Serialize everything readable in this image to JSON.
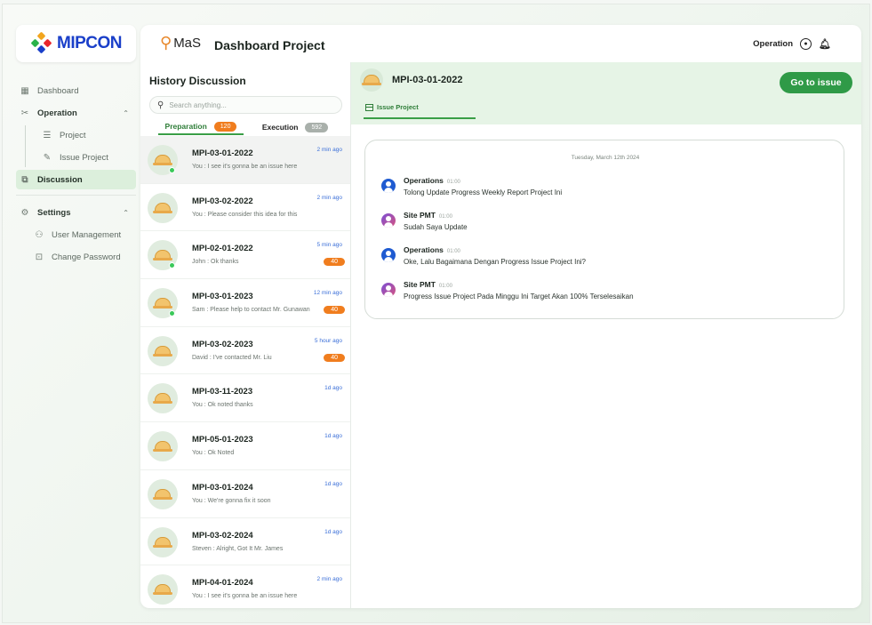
{
  "brand": {
    "logo_text": "MIPCON",
    "colors": {
      "brand_blue": "#1a3fc9",
      "accent_green": "#2f9a47",
      "badge_orange": "#f07d1e"
    }
  },
  "sidebar": {
    "items": [
      {
        "label": "Dashboard",
        "icon": "grid-icon"
      },
      {
        "label": "Operation",
        "icon": "tools-icon"
      },
      {
        "label": "Project",
        "icon": "lines-icon"
      },
      {
        "label": "Issue Project",
        "icon": "pencil-icon"
      },
      {
        "label": "Discussion",
        "icon": "chat-icon"
      },
      {
        "label": "Settings",
        "icon": "gear-icon"
      },
      {
        "label": "User Management",
        "icon": "user-gear-icon"
      },
      {
        "label": "Change Password",
        "icon": "lock-icon"
      }
    ]
  },
  "header": {
    "app_mark": "MaS",
    "title": "Dashboard Project",
    "user_label": "Operation"
  },
  "history": {
    "title": "History Discussion",
    "search_placeholder": "Search anything...",
    "tabs": [
      {
        "label": "Preparation",
        "count": "120"
      },
      {
        "label": "Execution",
        "count": "592"
      }
    ],
    "rows": [
      {
        "title": "MPI-03-01-2022",
        "msg": "You : I see it's gonna be an issue here",
        "time": "2 min ago",
        "badge": ""
      },
      {
        "title": "MPI-03-02-2022",
        "msg": "You : Please consider this idea for this",
        "time": "2 min ago",
        "badge": ""
      },
      {
        "title": "MPI-02-01-2022",
        "msg": "John : Ok thanks",
        "time": "5 min ago",
        "badge": "40"
      },
      {
        "title": "MPI-03-01-2023",
        "msg": "Sam : Please help to contact Mr. Gunawan",
        "time": "12 min ago",
        "badge": "40"
      },
      {
        "title": "MPI-03-02-2023",
        "msg": "David : I've contacted Mr. Liu",
        "time": "5 hour ago",
        "badge": "40"
      },
      {
        "title": "MPI-03-11-2023",
        "msg": "You : Ok noted thanks",
        "time": "1d ago",
        "badge": ""
      },
      {
        "title": "MPI-05-01-2023",
        "msg": "You : Ok Noted",
        "time": "1d ago",
        "badge": ""
      },
      {
        "title": "MPI-03-01-2024",
        "msg": "You : We're gonna fix it soon",
        "time": "1d ago",
        "badge": ""
      },
      {
        "title": "MPI-03-02-2024",
        "msg": "Steven : Alright, Got It Mr. James",
        "time": "1d ago",
        "badge": ""
      },
      {
        "title": "MPI-04-01-2024",
        "msg": "You : I see it's gonna be an issue here",
        "time": "2 min ago",
        "badge": ""
      }
    ]
  },
  "chat": {
    "title": "MPI-03-01-2022",
    "go_button": "Go to issue",
    "tab_label": "Issue Project",
    "date": "Tuesday, March 12th 2024",
    "messages": [
      {
        "name": "Operations",
        "time": "01:00",
        "text": "Tolong Update Progress Weekly Report Project Ini"
      },
      {
        "name": "Site PMT",
        "time": "01:00",
        "text": "Sudah Saya Update"
      },
      {
        "name": "Operations",
        "time": "01:00",
        "text": "Oke, Lalu Bagaimana Dengan Progress Issue Project Ini?"
      },
      {
        "name": "Site PMT",
        "time": "01:00",
        "text": "Progress Issue Project Pada Minggu Ini Target Akan 100% Terselesaikan"
      }
    ]
  }
}
